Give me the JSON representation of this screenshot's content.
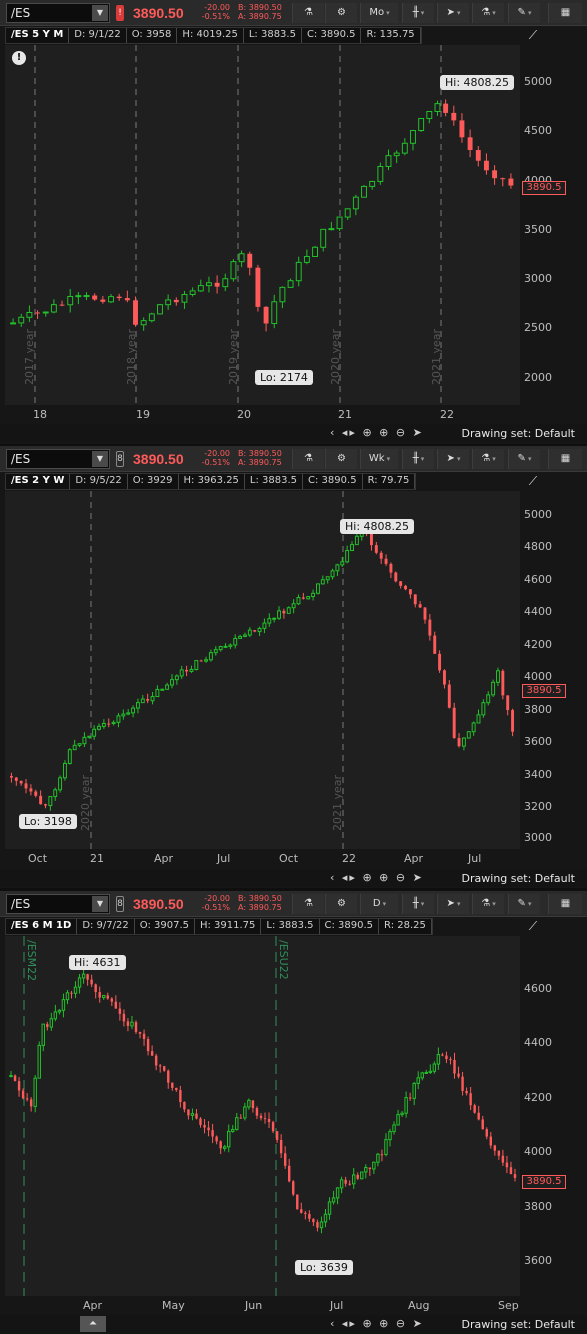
{
  "common": {
    "symbol": "/ES",
    "last_price": "3890.50",
    "change": "-20.00",
    "change_pct": "-0.51%",
    "bid": "B: 3890.50",
    "ask": "A: 3890.75",
    "price_tag": "3890.5",
    "drawing_set": "Drawing set: Default",
    "colors": {
      "up": "#22c02a",
      "down": "#ff5a5a",
      "accent": "#ff5a5a"
    }
  },
  "panels": [
    {
      "aggregation": "Mo",
      "info": {
        "label": "/ES 5 Y M",
        "date": "D: 9/1/22",
        "open": "O: 3958",
        "high": "H: 4019.25",
        "low": "L: 3883.5",
        "close": "C: 3890.5",
        "range": "R: 135.75"
      },
      "hi_label": "Hi: 4808.25",
      "lo_label": "Lo: 2174",
      "y_ticks": [
        "5000",
        "4500",
        "4000",
        "3500",
        "3000",
        "2500",
        "2000"
      ],
      "x_ticks": [
        "18",
        "19",
        "20",
        "21",
        "22"
      ],
      "period_labels": [
        "2017 year",
        "2018 year",
        "2019 year",
        "2020 year",
        "2021 year"
      ]
    },
    {
      "aggregation": "Wk",
      "info": {
        "label": "/ES 2 Y W",
        "date": "D: 9/5/22",
        "open": "O: 3929",
        "high": "H: 3963.25",
        "low": "L: 3883.5",
        "close": "C: 3890.5",
        "range": "R: 79.75"
      },
      "hi_label": "Hi: 4808.25",
      "lo_label": "Lo: 3198",
      "y_ticks": [
        "5000",
        "4800",
        "4600",
        "4400",
        "4200",
        "4000",
        "3800",
        "3600",
        "3400",
        "3200",
        "3000"
      ],
      "x_ticks": [
        "Oct",
        "21",
        "Apr",
        "Jul",
        "Oct",
        "22",
        "Apr",
        "Jul"
      ],
      "period_labels": [
        "2020 year",
        "2021 year"
      ]
    },
    {
      "aggregation": "D",
      "info": {
        "label": "/ES 6 M 1D",
        "date": "D: 9/7/22",
        "open": "O: 3907.5",
        "high": "H: 3911.75",
        "low": "L: 3883.5",
        "close": "C: 3890.5",
        "range": "R: 28.25"
      },
      "hi_label": "Hi: 4631",
      "lo_label": "Lo: 3639",
      "y_ticks": [
        "4600",
        "4400",
        "4200",
        "4000",
        "3800",
        "3600"
      ],
      "x_ticks": [
        "Apr",
        "May",
        "Jun",
        "Jul",
        "Aug",
        "Sep"
      ],
      "period_labels": [
        "/ESM22",
        "/ESU22"
      ]
    }
  ]
}
